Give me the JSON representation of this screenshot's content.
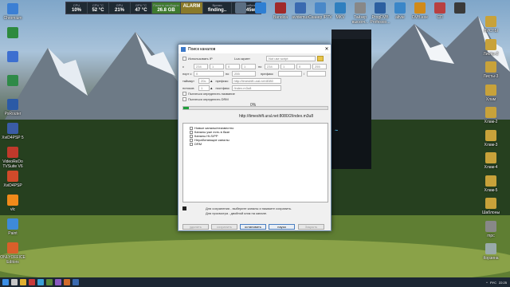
{
  "top_widget": {
    "cells": [
      {
        "label": "CPU",
        "value": "10%"
      },
      {
        "label": "CPU °C",
        "value": "52 °C"
      },
      {
        "label": "GPU",
        "value": "21%"
      },
      {
        "label": "GPU °C",
        "value": "47 °C"
      },
      {
        "label": "Память свободно",
        "value": "26.8 GB"
      },
      {
        "label": "",
        "value": "ALARM"
      },
      {
        "label": "Время",
        "value": "finding.."
      },
      {
        "label": "Время работы",
        "value": "10ч 45м"
      }
    ]
  },
  "desktop_icons_left": [
    {
      "label": "Chromium",
      "color": "#3b7fd4"
    },
    {
      "label": "",
      "color": "#2d8a3e"
    },
    {
      "label": "",
      "color": "#3d6fd0"
    },
    {
      "label": "",
      "color": "#2f8a48"
    },
    {
      "label": "PsRouter",
      "color": "#2b5aa6"
    },
    {
      "label": "XviD4PSP 5",
      "color": "#3a5ca6"
    },
    {
      "label": "VideoReDo TVSuite V6",
      "color": "#c0392b"
    },
    {
      "label": "XviD4PSP",
      "color": "#d04a2a"
    },
    {
      "label": "vlc",
      "color": "#f08a1a"
    },
    {
      "label": "Paint",
      "color": "#3e8ad8"
    },
    {
      "label": "ONLYOFFICE Editors",
      "color": "#d95f2a"
    }
  ],
  "desktop_icons_top": [
    {
      "label": "",
      "color": "#5b6e82"
    },
    {
      "label": "",
      "color": "#2e7fd3"
    },
    {
      "label": "Bandica",
      "color": "#a02a2a"
    },
    {
      "label": "avidemux",
      "color": "#3a6ab0"
    },
    {
      "label": "Сканер IPTV",
      "color": "#4a88c8"
    },
    {
      "label": "MKV",
      "color": "#2f7fbf"
    },
    {
      "label": "Тайзер выскоч...",
      "color": "#888"
    },
    {
      "label": "ProgDVB Professio...",
      "color": "#2c5fa0"
    },
    {
      "label": "altvie",
      "color": "#3a86c8"
    },
    {
      "label": "DVB.exe",
      "color": "#d08a1a"
    },
    {
      "label": "СП",
      "color": "#b84040"
    },
    {
      "label": "",
      "color": "#3a3a3a"
    }
  ],
  "desktop_icons_right": [
    {
      "label": "ЛИСТЫ",
      "color": "#c8a23a"
    },
    {
      "label": "Листы-2",
      "color": "#c8a23a"
    },
    {
      "label": "Листы-3",
      "color": "#c8a23a"
    },
    {
      "label": "Хлам",
      "color": "#c8a23a"
    },
    {
      "label": "Хлам-2",
      "color": "#c8a23a"
    },
    {
      "label": "Хлам-3",
      "color": "#c8a23a"
    },
    {
      "label": "Хлам-4",
      "color": "#c8a23a"
    },
    {
      "label": "Хлам-5",
      "color": "#c8a23a"
    },
    {
      "label": "Шаблоны",
      "color": "#c8a23a"
    },
    {
      "label": "mpc",
      "color": "#888"
    },
    {
      "label": "Корзина",
      "color": "#9aa"
    }
  ],
  "dialog": {
    "title": "Поиск каналов",
    "use_ip_label": "Использовать IP",
    "script_label": "Lua скрипт",
    "not_used_label": "Not use script",
    "ip_prefix": "с",
    "ip_octets": [
      "234",
      "1",
      "0",
      "1"
    ],
    "to_label": "по",
    "ip_end_octets": [
      "234",
      "1",
      "0",
      "255"
    ],
    "port_label": "порт с",
    "port_from": "0",
    "port_to_label": "по",
    "port_to": "255",
    "prefix_label": "префикс",
    "timeout_label": "таймаут",
    "timeout_value": "20с",
    "threads_label": "потоков",
    "threads_value": "1",
    "prefix_value": "http://timeshift.ural.net:8080",
    "postfix_label": "постфикс",
    "postfix_value": "/index.m3u8",
    "detect_name_label": "Пытаться определить название",
    "detect_drm_label": "Пытаться определить DRM",
    "progress_text": "0%",
    "progress_fraction": 0.04,
    "current_url": "http://timeshift.ural.net:8080/2/index.m3u8",
    "tree": [
      "Новые каналы/неизвестно",
      "Каналы уже есть в базе",
      "Каналы HLS/PP",
      "Неработающие каналы",
      "DRM"
    ],
    "hint1": "Для сохранения - выберите каналы и нажмите сохранить.",
    "hint2": "Для просмотра - двойной клик на канале.",
    "buttons": [
      "удалить",
      "сохранить",
      "остановить",
      "пауза",
      "Закрыть"
    ]
  },
  "taskbar": {
    "lang": "РУС",
    "time": "22:25"
  }
}
